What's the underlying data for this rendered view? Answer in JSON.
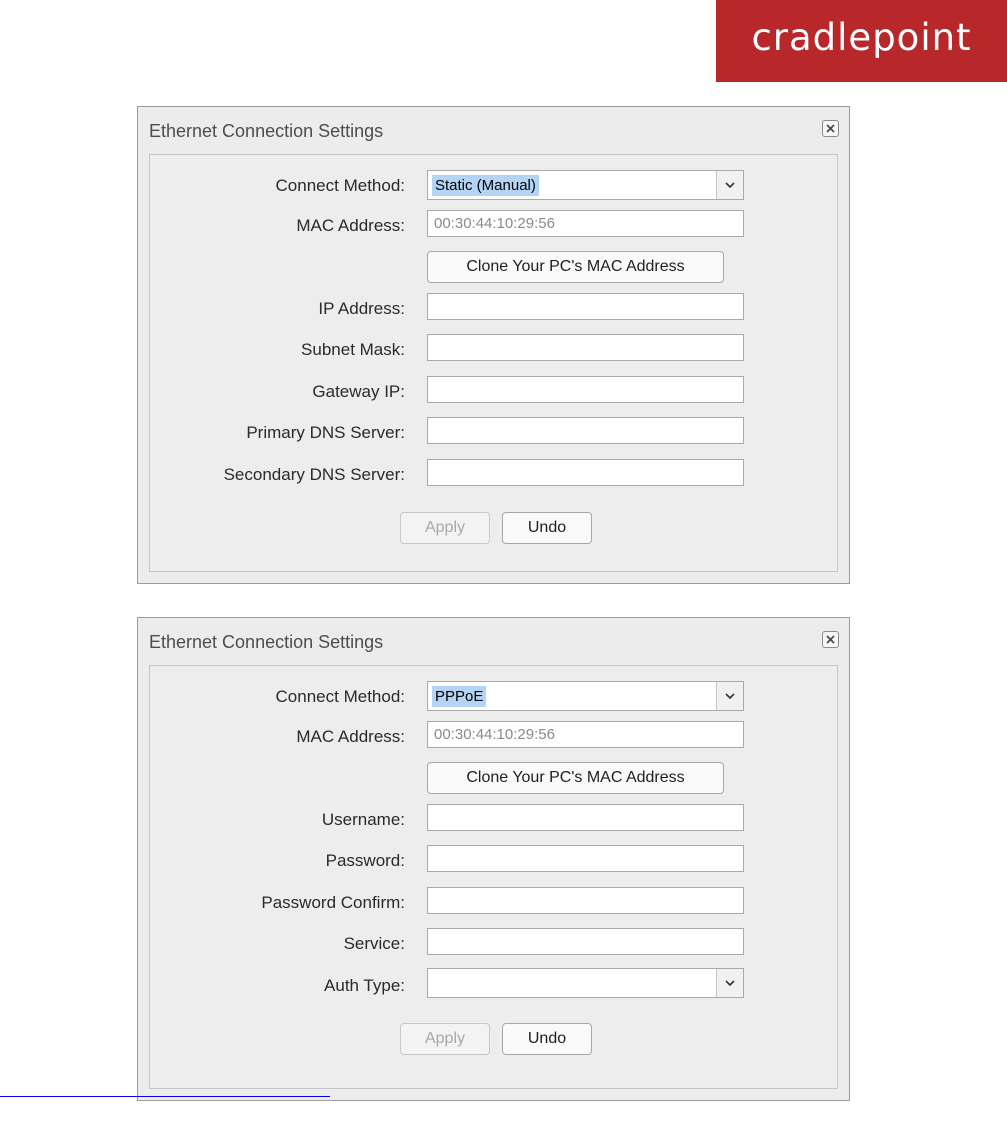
{
  "logo": {
    "text": "cradlepoint",
    "color": "#b8282b"
  },
  "dialogs": [
    {
      "title": "Ethernet Connection Settings",
      "close_icon": "close-icon",
      "connect_method": {
        "label": "Connect Method:",
        "value": "Static (Manual)"
      },
      "mac": {
        "label": "MAC Address:",
        "value": "00:30:44:10:29:56"
      },
      "clone_button": "Clone Your PC's MAC Address",
      "fields": [
        {
          "label": "IP Address:",
          "value": ""
        },
        {
          "label": "Subnet Mask:",
          "value": ""
        },
        {
          "label": "Gateway IP:",
          "value": ""
        },
        {
          "label": "Primary DNS Server:",
          "value": ""
        },
        {
          "label": "Secondary DNS Server:",
          "value": ""
        }
      ],
      "apply_label": "Apply",
      "undo_label": "Undo"
    },
    {
      "title": "Ethernet Connection Settings",
      "close_icon": "close-icon",
      "connect_method": {
        "label": "Connect Method:",
        "value": "PPPoE"
      },
      "mac": {
        "label": "MAC Address:",
        "value": "00:30:44:10:29:56"
      },
      "clone_button": "Clone Your PC's MAC Address",
      "fields": [
        {
          "label": "Username:",
          "value": ""
        },
        {
          "label": "Password:",
          "value": ""
        },
        {
          "label": "Password Confirm:",
          "value": ""
        },
        {
          "label": "Service:",
          "value": ""
        }
      ],
      "auth_type": {
        "label": "Auth Type:",
        "value": ""
      },
      "apply_label": "Apply",
      "undo_label": "Undo"
    }
  ]
}
